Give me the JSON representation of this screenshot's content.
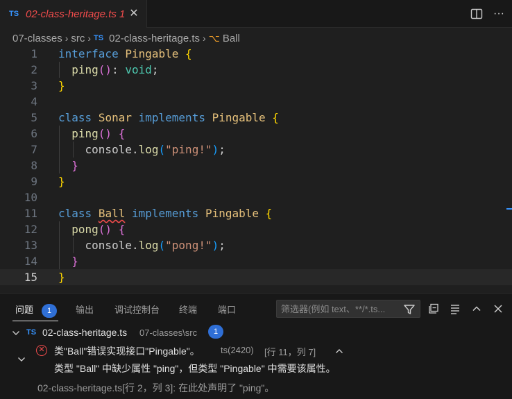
{
  "tab": {
    "lang_badge": "TS",
    "title": "02-class-heritage.ts 1",
    "close": "✕"
  },
  "toolbar": {
    "more": "···"
  },
  "breadcrumb": {
    "folder": "07-classes",
    "sub": "src",
    "file_badge": "TS",
    "file": "02-class-heritage.ts",
    "symbol": "Ball"
  },
  "code": {
    "line_numbers": [
      "1",
      "2",
      "3",
      "4",
      "5",
      "6",
      "7",
      "8",
      "9",
      "10",
      "11",
      "12",
      "13",
      "14",
      "15"
    ],
    "l1": {
      "kw": "interface",
      "name": "Pingable",
      "brace": "{"
    },
    "l2": {
      "fn": "ping",
      "parens": "()",
      "colon": ":",
      "type": "void",
      "semi": ";"
    },
    "l3": {
      "brace": "}"
    },
    "l5": {
      "kw": "class",
      "name": "Sonar",
      "impl": "implements",
      "iface": "Pingable",
      "brace": "{"
    },
    "l6": {
      "fn": "ping",
      "parens": "()",
      "brace": "{"
    },
    "l7": {
      "obj": "console",
      "dot": ".",
      "fn": "log",
      "open": "(",
      "str": "\"ping!\"",
      "close": ")",
      "semi": ";"
    },
    "l8": {
      "brace": "}"
    },
    "l9": {
      "brace": "}"
    },
    "l11": {
      "kw": "class",
      "name": "Ball",
      "impl": "implements",
      "iface": "Pingable",
      "brace": "{"
    },
    "l12": {
      "fn": "pong",
      "parens": "()",
      "brace": "{"
    },
    "l13": {
      "obj": "console",
      "dot": ".",
      "fn": "log",
      "open": "(",
      "str": "\"pong!\"",
      "close": ")",
      "semi": ";"
    },
    "l14": {
      "brace": "}"
    },
    "l15": {
      "brace": "}"
    }
  },
  "panel": {
    "tabs": {
      "problems": "问题",
      "problems_count": "1",
      "output": "输出",
      "debug_console": "调试控制台",
      "terminal": "终端",
      "ports": "端口"
    },
    "filter_placeholder": "筛选器(例如 text、**/*.ts...",
    "file_row": {
      "badge": "TS",
      "file": "02-class-heritage.ts",
      "path": "07-classes\\src",
      "count": "1"
    },
    "error": {
      "message": "类\"Ball\"错误实现接口\"Pingable\"。",
      "source": "ts(2420)",
      "location": "[行 11，列 7]",
      "detail": "类型 \"Ball\" 中缺少属性 \"ping\"，但类型 \"Pingable\" 中需要该属性。",
      "related": "02-class-heritage.ts[行 2，列 3]: 在此处声明了 \"ping\"。"
    }
  },
  "colors": {
    "accent": "#3794ff",
    "error": "#f14c4c",
    "badge": "#2f6fd6"
  }
}
